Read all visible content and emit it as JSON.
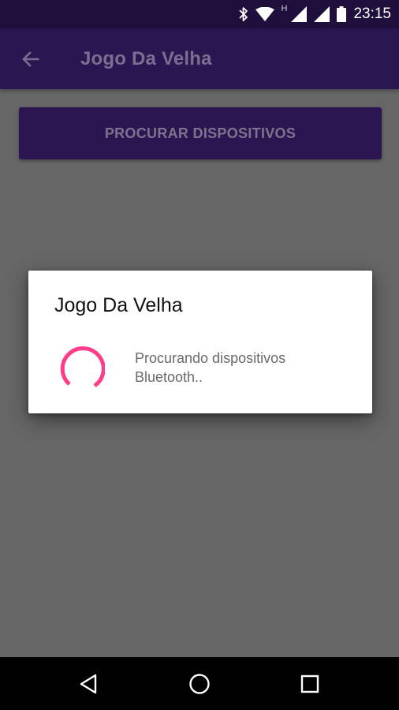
{
  "status_bar": {
    "time": "23:15",
    "network_type": "H",
    "icons": [
      "bluetooth-icon",
      "wifi-icon",
      "cell-signal-icon",
      "cell-signal-icon",
      "battery-icon"
    ]
  },
  "app_bar": {
    "title": "Jogo Da Velha",
    "back_icon": "arrow-left-icon"
  },
  "main": {
    "scan_button_label": "PROCURAR DISPOSITIVOS"
  },
  "dialog": {
    "title": "Jogo Da Velha",
    "message": "Procurando dispositivos Bluetooth..",
    "spinner_icon": "progress-spinner-icon",
    "spinner_color": "#ff3d8b"
  },
  "nav_bar": {
    "icons": [
      "nav-back-icon",
      "nav-home-icon",
      "nav-recents-icon"
    ]
  },
  "colors": {
    "primary_dark": "#1f0f3c",
    "primary": "#2a1650",
    "accent": "#ff3d8b",
    "scrim": "#666666"
  }
}
